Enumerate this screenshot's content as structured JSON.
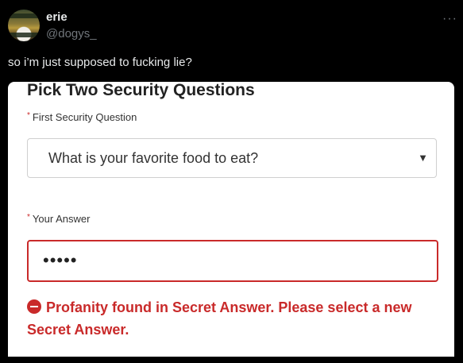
{
  "tweet": {
    "author_name": "erie",
    "handle": "@dogys_",
    "more_icon": "···",
    "text": "so i’m just supposed to fucking lie?"
  },
  "form": {
    "title": "Pick Two Security Questions",
    "required_marker": "*",
    "question_label": "First Security Question",
    "question_value": "What is your favorite food to eat?",
    "dropdown_arrow": "▼",
    "answer_label": "Your Answer",
    "answer_value": "•••••",
    "error_message": "Profanity found in Secret Answer. Please select a new Secret Answer.",
    "error_color": "#c92a2a"
  }
}
